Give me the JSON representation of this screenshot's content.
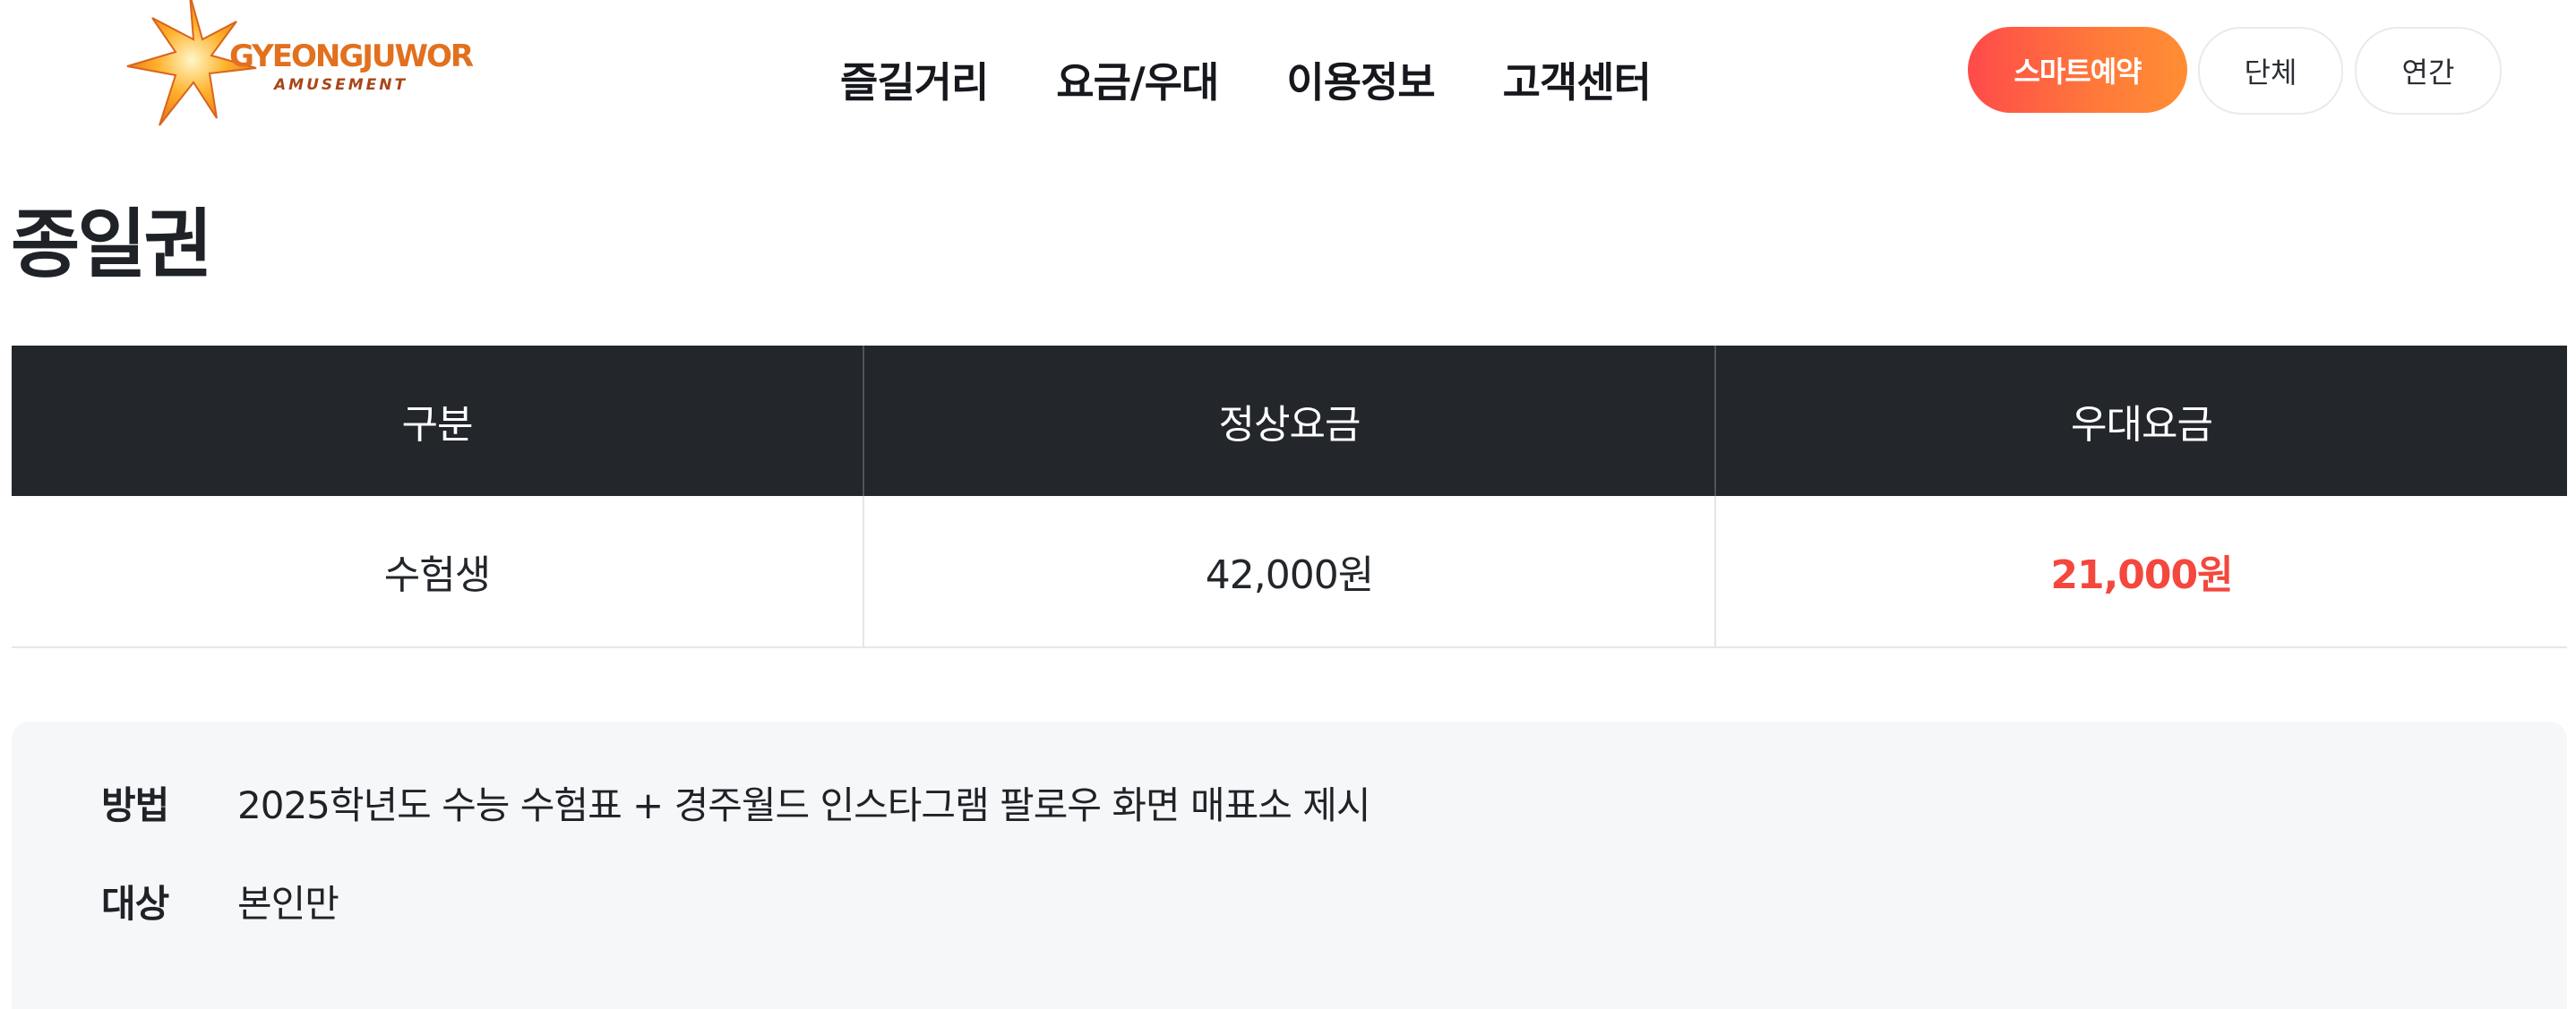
{
  "header": {
    "logo": {
      "brand": "GYEONGJUWORLD",
      "sub": "AMUSEMENT"
    },
    "nav": [
      {
        "label": "즐길거리"
      },
      {
        "label": "요금/우대"
      },
      {
        "label": "이용정보"
      },
      {
        "label": "고객센터"
      }
    ],
    "buttons": {
      "smart": "스마트예약",
      "group": "단체",
      "annual": "연간"
    }
  },
  "page": {
    "title": "종일권"
  },
  "table": {
    "headers": [
      "구분",
      "정상요금",
      "우대요금"
    ],
    "rows": [
      {
        "category": "수험생",
        "regular": "42,000원",
        "discount": "21,000원"
      }
    ]
  },
  "info": [
    {
      "label": "방법",
      "value": "2025학년도 수능 수험표 + 경주월드 인스타그램 팔로우 화면 매표소 제시"
    },
    {
      "label": "대상",
      "value": "본인만"
    }
  ],
  "colors": {
    "accent": "#ff6a3d",
    "discount": "#f4473e",
    "table_header": "#23262b"
  }
}
